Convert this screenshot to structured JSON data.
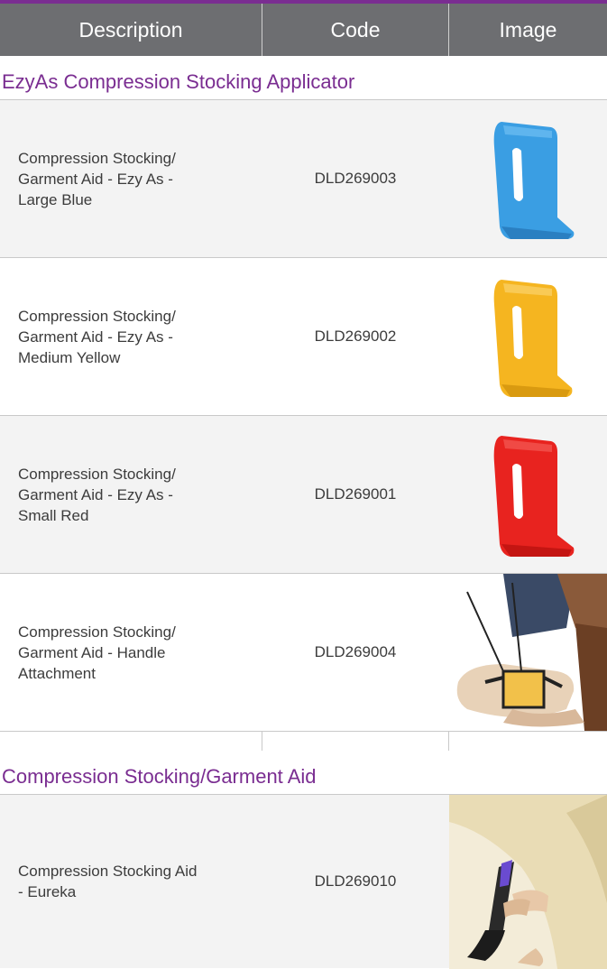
{
  "header": {
    "description": "Description",
    "code": "Code",
    "image": "Image"
  },
  "colors": {
    "accent": "#7a2d91",
    "header_bg": "#6d6e71"
  },
  "sections": [
    {
      "title": "EzyAs Compression Stocking Applicator",
      "rows": [
        {
          "desc_lines": [
            "Compression Stocking/",
            "Garment Aid - Ezy As -",
            "Large Blue"
          ],
          "code": "DLD269003",
          "image": "blue-applicator"
        },
        {
          "desc_lines": [
            "Compression Stocking/",
            "Garment Aid - Ezy As -",
            "Medium Yellow"
          ],
          "code": "DLD269002",
          "image": "yellow-applicator"
        },
        {
          "desc_lines": [
            "Compression Stocking/",
            "Garment Aid - Ezy As -",
            "Small Red"
          ],
          "code": "DLD269001",
          "image": "red-applicator"
        },
        {
          "desc_lines": [
            "Compression Stocking/",
            "Garment Aid - Handle",
            "Attachment"
          ],
          "code": "DLD269004",
          "image": "handle-attachment-photo"
        }
      ]
    },
    {
      "title": "Compression Stocking/Garment Aid",
      "rows": [
        {
          "desc_lines": [
            "Compression Stocking Aid",
            "- Eureka"
          ],
          "code": "DLD269010",
          "image": "eureka-aid-photo"
        }
      ]
    }
  ]
}
